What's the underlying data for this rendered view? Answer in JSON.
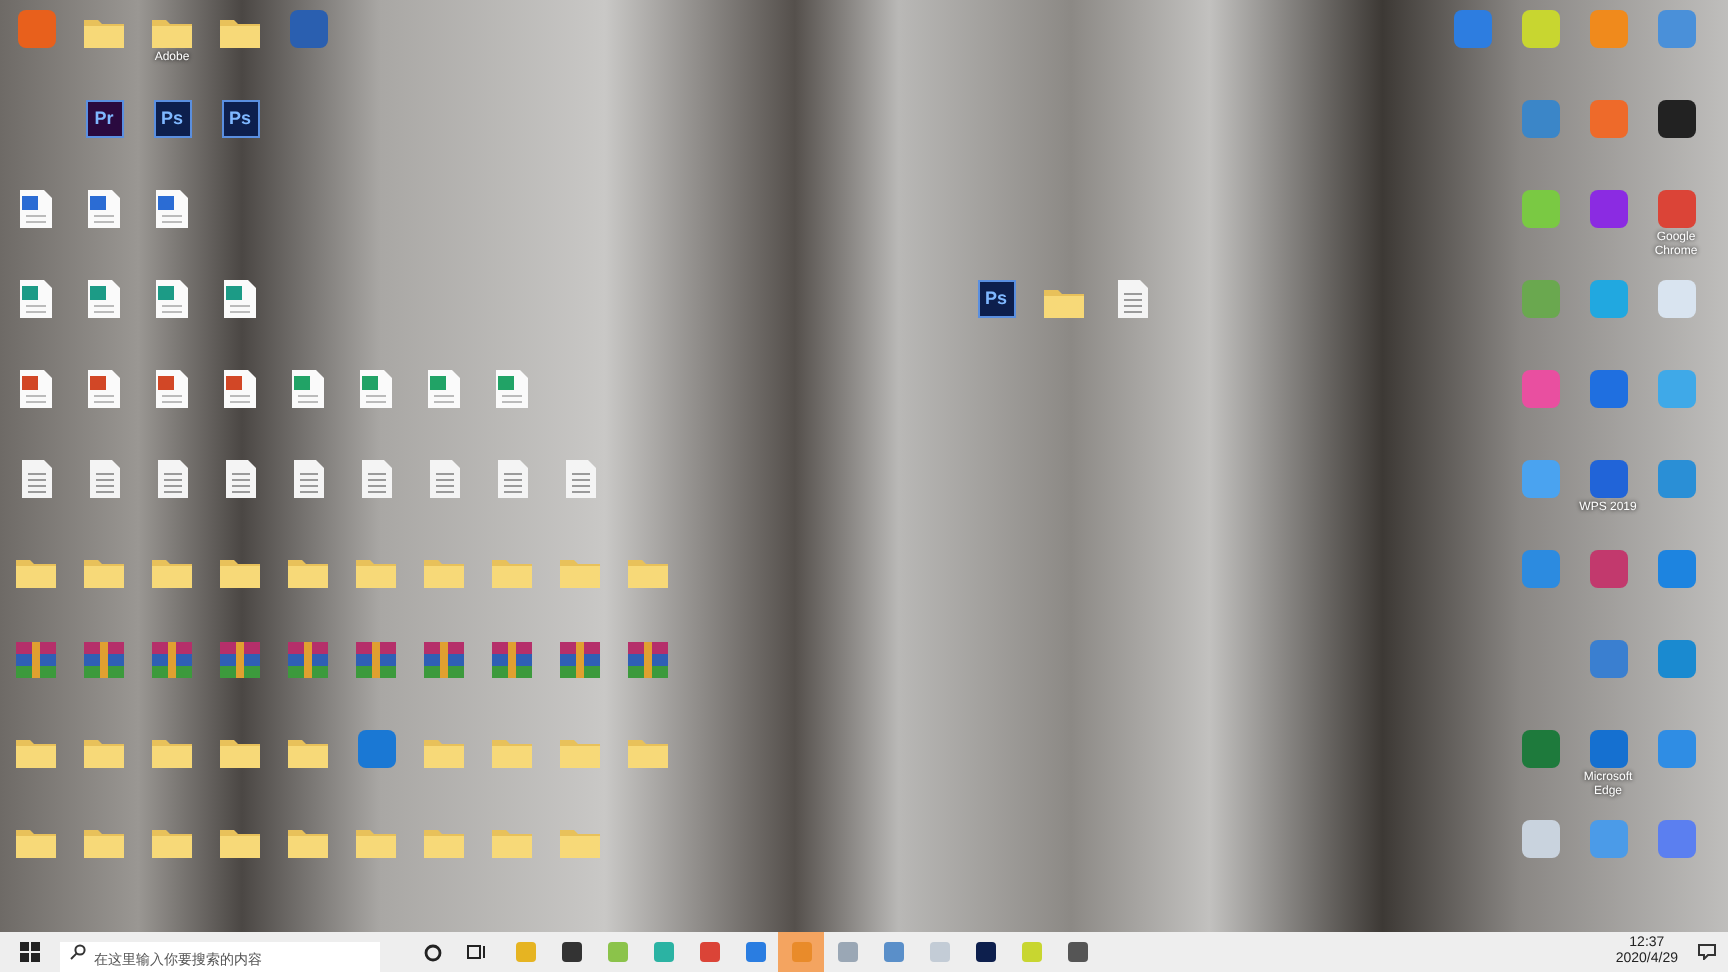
{
  "desktop_left": [
    [
      {
        "kind": "app",
        "color": "#e8601c"
      },
      {
        "kind": "folder"
      },
      {
        "kind": "folder",
        "label": "Adobe"
      },
      {
        "kind": "folder"
      },
      {
        "kind": "app",
        "color": "#2a5fb0"
      }
    ],
    [
      {
        "kind": "blank"
      },
      {
        "kind": "badge",
        "badge": "Pr",
        "color": "#2a0a3f"
      },
      {
        "kind": "badge",
        "badge": "Ps",
        "color": "#0d1f4d"
      },
      {
        "kind": "badge",
        "badge": "Ps",
        "color": "#0d1f4d"
      }
    ],
    [
      {
        "kind": "word"
      },
      {
        "kind": "word"
      },
      {
        "kind": "word"
      }
    ],
    [
      {
        "kind": "setup"
      },
      {
        "kind": "setup"
      },
      {
        "kind": "setup"
      },
      {
        "kind": "setup"
      }
    ],
    [
      {
        "kind": "ppt"
      },
      {
        "kind": "ppt"
      },
      {
        "kind": "ppt"
      },
      {
        "kind": "ppt"
      },
      {
        "kind": "excel"
      },
      {
        "kind": "excel"
      },
      {
        "kind": "excel"
      },
      {
        "kind": "excel"
      }
    ],
    [
      {
        "kind": "doc"
      },
      {
        "kind": "doc"
      },
      {
        "kind": "doc"
      },
      {
        "kind": "doc"
      },
      {
        "kind": "doc"
      },
      {
        "kind": "doc"
      },
      {
        "kind": "doc"
      },
      {
        "kind": "doc"
      },
      {
        "kind": "doc"
      }
    ],
    [
      {
        "kind": "folder"
      },
      {
        "kind": "folder"
      },
      {
        "kind": "folder"
      },
      {
        "kind": "folder"
      },
      {
        "kind": "folder"
      },
      {
        "kind": "folder"
      },
      {
        "kind": "folder"
      },
      {
        "kind": "folder"
      },
      {
        "kind": "folder"
      },
      {
        "kind": "folder"
      }
    ],
    [
      {
        "kind": "rar"
      },
      {
        "kind": "rar"
      },
      {
        "kind": "rar"
      },
      {
        "kind": "rar"
      },
      {
        "kind": "rar"
      },
      {
        "kind": "rar"
      },
      {
        "kind": "rar"
      },
      {
        "kind": "rar"
      },
      {
        "kind": "rar"
      },
      {
        "kind": "rar"
      }
    ],
    [
      {
        "kind": "folder"
      },
      {
        "kind": "folder"
      },
      {
        "kind": "folder"
      },
      {
        "kind": "folder"
      },
      {
        "kind": "folder"
      },
      {
        "kind": "app",
        "color": "#1a78d4"
      },
      {
        "kind": "folder"
      },
      {
        "kind": "folder"
      },
      {
        "kind": "folder"
      },
      {
        "kind": "folder"
      }
    ],
    [
      {
        "kind": "folder"
      },
      {
        "kind": "folder"
      },
      {
        "kind": "folder"
      },
      {
        "kind": "folder"
      },
      {
        "kind": "folder"
      },
      {
        "kind": "folder"
      },
      {
        "kind": "folder"
      },
      {
        "kind": "folder"
      },
      {
        "kind": "folder"
      }
    ]
  ],
  "desktop_middle": [
    {
      "kind": "badge",
      "badge": "Ps",
      "color": "#0d1f4d"
    },
    {
      "kind": "folder"
    },
    {
      "kind": "doc"
    }
  ],
  "desktop_right": [
    [
      {
        "kind": "app",
        "color": "#2d7de0"
      },
      {
        "kind": "app",
        "color": "#c8d630"
      },
      {
        "kind": "app",
        "color": "#f08a1c"
      },
      {
        "kind": "app",
        "color": "#4a90d9"
      }
    ],
    [
      {
        "kind": "blank"
      },
      {
        "kind": "app",
        "color": "#3b86c8"
      },
      {
        "kind": "app",
        "color": "#ee6a2a"
      },
      {
        "kind": "app",
        "color": "#222222"
      }
    ],
    [
      {
        "kind": "blank"
      },
      {
        "kind": "app",
        "color": "#7ac943"
      },
      {
        "kind": "app",
        "color": "#8b2be2"
      },
      {
        "kind": "app",
        "color": "#db4437",
        "label": "Google Chrome"
      }
    ],
    [
      {
        "kind": "blank"
      },
      {
        "kind": "app",
        "color": "#6aa84f"
      },
      {
        "kind": "app",
        "color": "#21a8e0"
      },
      {
        "kind": "app",
        "color": "#d9e4f0"
      }
    ],
    [
      {
        "kind": "blank"
      },
      {
        "kind": "app",
        "color": "#e94fa0"
      },
      {
        "kind": "app",
        "color": "#1f6fe0"
      },
      {
        "kind": "app",
        "color": "#3fa9e8"
      }
    ],
    [
      {
        "kind": "blank"
      },
      {
        "kind": "app",
        "color": "#4aa3f0"
      },
      {
        "kind": "app",
        "color": "#2164d8",
        "label": "WPS 2019"
      },
      {
        "kind": "app",
        "color": "#2a8fd6"
      }
    ],
    [
      {
        "kind": "blank"
      },
      {
        "kind": "app",
        "color": "#2c8be0"
      },
      {
        "kind": "app",
        "color": "#c2396d"
      },
      {
        "kind": "app",
        "color": "#1d84e0"
      }
    ],
    [
      {
        "kind": "blank"
      },
      {
        "kind": "blank"
      },
      {
        "kind": "app",
        "color": "#3a7fd0"
      },
      {
        "kind": "app",
        "color": "#1a8ad0"
      }
    ],
    [
      {
        "kind": "blank"
      },
      {
        "kind": "app",
        "color": "#1e7a3c"
      },
      {
        "kind": "app",
        "color": "#1570d0",
        "label": "Microsoft Edge"
      },
      {
        "kind": "app",
        "color": "#2f8de4"
      }
    ],
    [
      {
        "kind": "blank"
      },
      {
        "kind": "app",
        "color": "#c9d3de"
      },
      {
        "kind": "app",
        "color": "#4b9be8"
      },
      {
        "kind": "app",
        "color": "#5b7ff0"
      }
    ]
  ],
  "taskbar": {
    "search": {
      "placeholder": "在这里输入你要搜索的内容"
    },
    "apps": [
      {
        "color": "#e6b422",
        "selected": false
      },
      {
        "color": "#333333",
        "selected": false
      },
      {
        "color": "#8bc34a",
        "selected": false
      },
      {
        "color": "#2bb3a3",
        "selected": false
      },
      {
        "color": "#db4437",
        "selected": false
      },
      {
        "color": "#2a7de1",
        "selected": false
      },
      {
        "color": "#e98b2a",
        "selected": true
      },
      {
        "color": "#9aa7b5",
        "selected": false
      },
      {
        "color": "#5a8fc9",
        "selected": false
      },
      {
        "color": "#c3ccd6",
        "selected": false
      },
      {
        "color": "#0d1f4d",
        "selected": false
      },
      {
        "color": "#c8d630",
        "selected": false
      },
      {
        "color": "#555555",
        "selected": false
      }
    ],
    "time": "12:37",
    "date": "2020/4/29"
  }
}
